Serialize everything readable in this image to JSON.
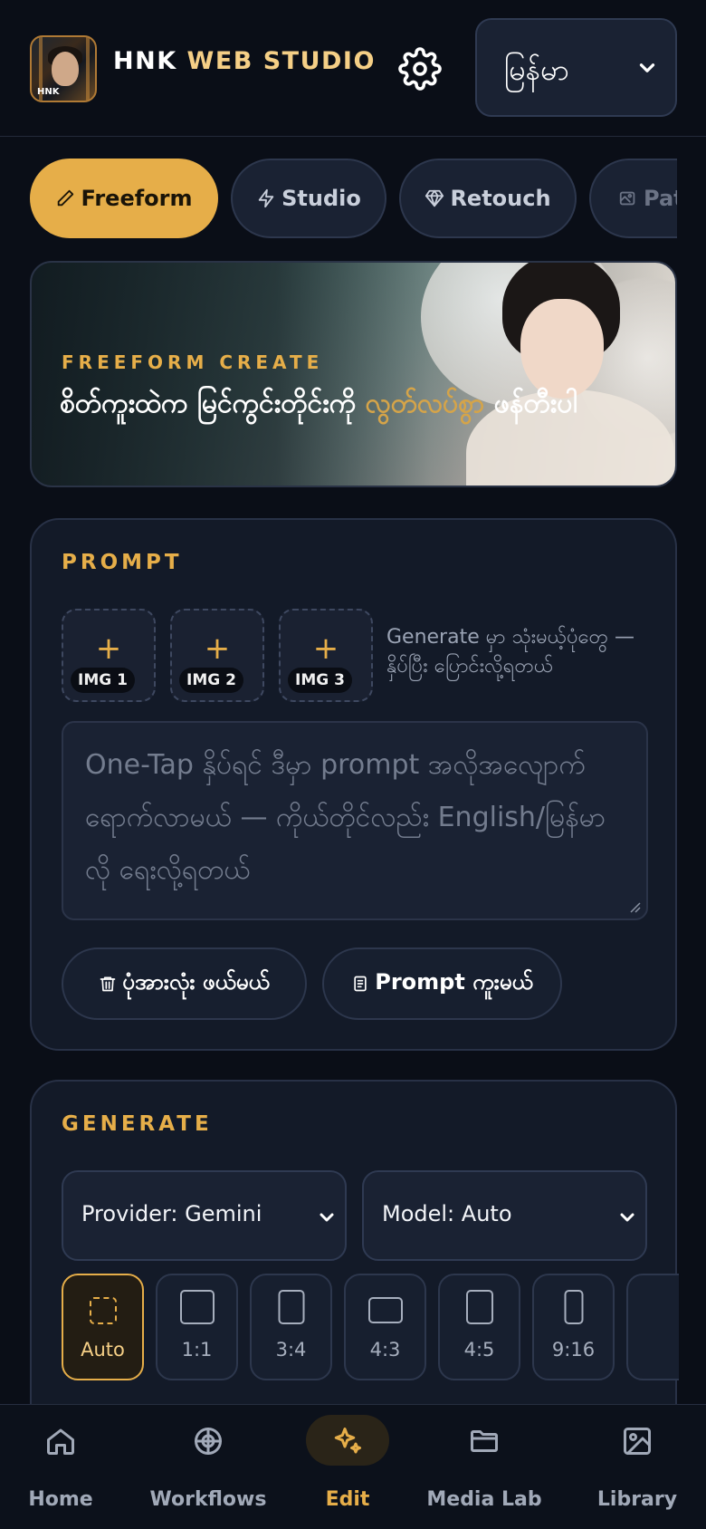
{
  "header": {
    "logo_text": "HNK",
    "brand_part1": "HNK",
    "brand_part2": "WEB STUDIO",
    "language": "မြန်မာ"
  },
  "mode_tabs": [
    {
      "label": "Freeform",
      "icon": "pencil-icon",
      "active": true
    },
    {
      "label": "Studio",
      "icon": "bolt-icon",
      "active": false
    },
    {
      "label": "Retouch",
      "icon": "diamond-icon",
      "active": false
    },
    {
      "label": "Pat",
      "icon": "gallery-icon",
      "active": false
    }
  ],
  "hero": {
    "eyebrow": "FREEFORM CREATE",
    "headline_before": "စိတ်ကူးထဲက မြင်ကွင်းတိုင်းကို ",
    "headline_highlight": "လွတ်လပ်စွာ",
    "headline_after": " ဖန်တီးပါ"
  },
  "prompt_card": {
    "title": "PROMPT",
    "slots": [
      "IMG 1",
      "IMG 2",
      "IMG 3"
    ],
    "slot_hint": "Generate မှာ သုံးမယ့်ပုံတွေ — နှိပ်ပြီး ပြောင်းလို့ရတယ်",
    "placeholder": "One-Tap နှိပ်ရင် ဒီမှာ prompt အလိုအလျောက် ရောက်လာမယ် — ကိုယ်တိုင်လည်း English/မြန်မာလို ရေးလို့ရတယ်",
    "clear_label": "ပုံအားလုံး ဖယ်မယ်",
    "copy_label": "Prompt ကူးမယ်"
  },
  "generate_card": {
    "title": "GENERATE",
    "provider": "Provider: Gemini",
    "model": "Model: Auto",
    "ratios": [
      "Auto",
      "1:1",
      "3:4",
      "4:3",
      "4:5",
      "9:16",
      ""
    ],
    "selected_ratio": "Auto"
  },
  "bottom_nav": [
    {
      "label": "Home",
      "icon": "home-icon"
    },
    {
      "label": "Workflows",
      "icon": "workflow-icon"
    },
    {
      "label": "Edit",
      "icon": "sparkle-icon",
      "active": true
    },
    {
      "label": "Media Lab",
      "icon": "folder-icon"
    },
    {
      "label": "Library",
      "icon": "image-icon"
    }
  ],
  "colors": {
    "background": "#0a0e17",
    "card": "#131a28",
    "accent": "#e6ae49",
    "brand_highlight": "#f5cf86"
  }
}
